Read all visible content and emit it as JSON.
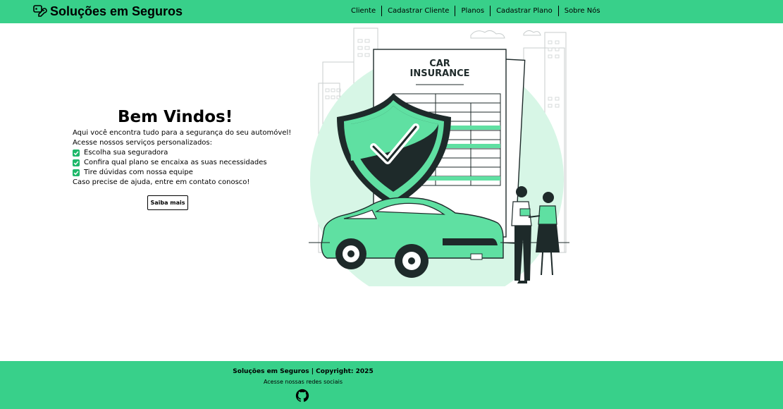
{
  "header": {
    "brand_icon": "car-key-icon",
    "brand_title": "Soluções em Seguros",
    "nav": [
      {
        "label": "Cliente"
      },
      {
        "label": "Cadastrar Cliente"
      },
      {
        "label": "Planos"
      },
      {
        "label": "Cadastrar Plano"
      },
      {
        "label": "Sobre Nós"
      }
    ]
  },
  "intro": {
    "title": "Bem Vindos!",
    "line1": "Aqui você encontra tudo para a segurança do seu automóvel!",
    "line2": "Acesse nossos serviços personalizados:",
    "checks": [
      {
        "icon": "checkbox-checked-icon",
        "text": "Escolha sua seguradora"
      },
      {
        "icon": "checkbox-checked-icon",
        "text": "Confira qual plano se encaixa as suas necessidades"
      },
      {
        "icon": "checkbox-checked-icon",
        "text": "Tire dúvidas com nossa equipe"
      }
    ],
    "line3": "Caso precise de ajuda, entre em contato conosco!",
    "cta_label": "Saiba mais"
  },
  "illustration": {
    "doc_title_line1": "CAR",
    "doc_title_line2": "INSURANCE"
  },
  "footer": {
    "copyright": "Soluções em Seguros | Copyright: 2025",
    "social_text": "Acesse nossas redes sociais",
    "social_icon": "github-icon"
  },
  "colors": {
    "accent": "#38d08a",
    "check": "#1fb86a",
    "illustration_green": "#5fe0a2",
    "illustration_light": "#d7f6e6",
    "dark": "#1e2a2a"
  }
}
